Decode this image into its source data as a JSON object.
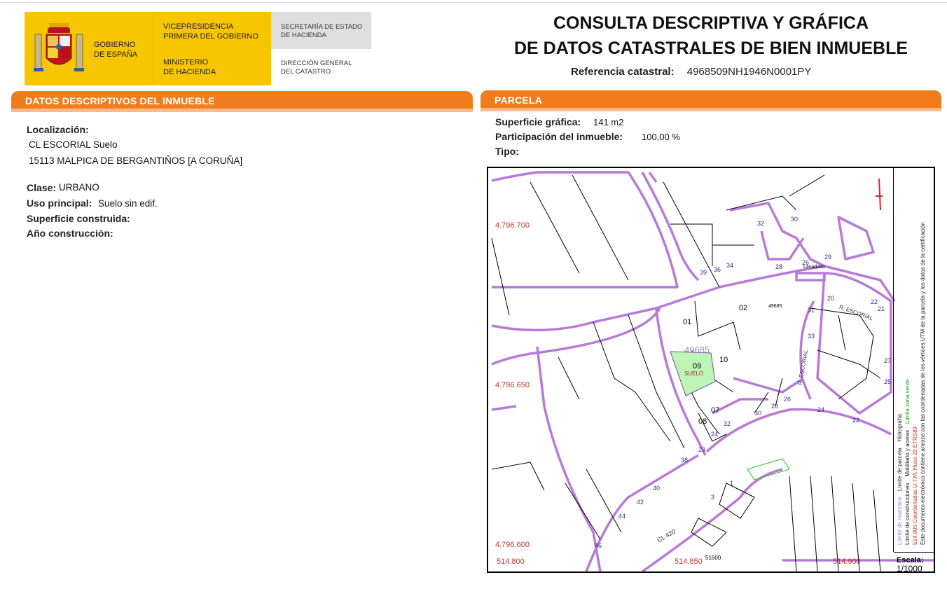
{
  "header": {
    "gov_line1": "GOBIERNO",
    "gov_line2": "DE ESPAÑA",
    "vice_line1": "VICEPRESIDENCIA",
    "vice_line2": "PRIMERA DEL GOBIERNO",
    "min_line1": "MINISTERIO",
    "min_line2": "DE HACIENDA",
    "sec_line1": "SECRETARÍA DE ESTADO",
    "sec_line2": "DE HACIENDA",
    "dir_line1": "DIRECCIÓN GENERAL",
    "dir_line2": "DEL CATASTRO",
    "title_line1": "CONSULTA DESCRIPTIVA Y GRÁFICA",
    "title_line2": "DE DATOS CATASTRALES DE BIEN INMUEBLE",
    "ref_label": "Referencia catastral:",
    "ref_value": "4968509NH1946N0001PY"
  },
  "left": {
    "section_title": "DATOS DESCRIPTIVOS DEL INMUEBLE",
    "localizacion_label": "Localización:",
    "localizacion_line1": "CL ESCORIAL  Suelo",
    "localizacion_line2": "15113 MALPICA DE BERGANTIÑOS [A CORUÑA]",
    "clase_label": "Clase:",
    "clase_value": "URBANO",
    "uso_label": "Uso principal:",
    "uso_value": "Suelo sin edif.",
    "sup_label": "Superficie construida:",
    "anio_label": "Año construcción:"
  },
  "right": {
    "section_title": "PARCELA",
    "sup_label": "Superficie gráfica:",
    "sup_value": "141 m2",
    "part_label": "Participación del inmueble:",
    "part_value": "100,00 %",
    "tipo_label": "Tipo:"
  },
  "map": {
    "coords": {
      "y1": "4.796.700",
      "y2": "4.796.650",
      "y3": "4.796.600",
      "x1": "514.800",
      "x2": "514.850",
      "x3": "514.900",
      "x2b": "51600"
    },
    "parcel_id": "49685",
    "parcel_id_small": "49685",
    "parcel_num": "09",
    "parcel_use": "SUELO",
    "labels": {
      "n01": "01",
      "n02": "02",
      "n07": "07",
      "n08": "08",
      "n10": "10",
      "n20": "20",
      "n21": "21",
      "n22": "22",
      "n23": "23",
      "n24": "24",
      "n26": "26",
      "n26b": "26",
      "n28": "28",
      "n28b": "28",
      "n29": "29",
      "n30": "30",
      "n31": "31",
      "n32": "32",
      "n32b": "32",
      "n33": "33",
      "n34": "34",
      "n36": "36",
      "n38": "38",
      "n39": "39",
      "n40": "40",
      "n42": "42",
      "n44": "44",
      "n46": "46",
      "n1": "1",
      "n3": "3",
      "n22b": "22",
      "n24b": "24",
      "n25": "25",
      "n27": "27",
      "n30b": "30",
      "street1": "R. ESCORIAL",
      "street2": "R. ESCORIAL",
      "street3": "CL 420",
      "lavadoiro": "Lavadoiro"
    },
    "legend": {
      "l1": "Límite de manzana",
      "l2": "Límite de parcela",
      "l3": "Límite de construcciones",
      "l4": "Mobiliario y aceras",
      "l5": "Límite zona verde",
      "l6": "Hidrografía",
      "coords_note": "514,900 Coordenadas U.T.M. Huso 29 ETRS89",
      "doc_note": "Este documento electrónico contiene anexos con las coordenadas de los vértices UTM de la parcela y los datos de la certificación"
    },
    "scale_label": "Escala:",
    "scale_value": "1/1000"
  }
}
